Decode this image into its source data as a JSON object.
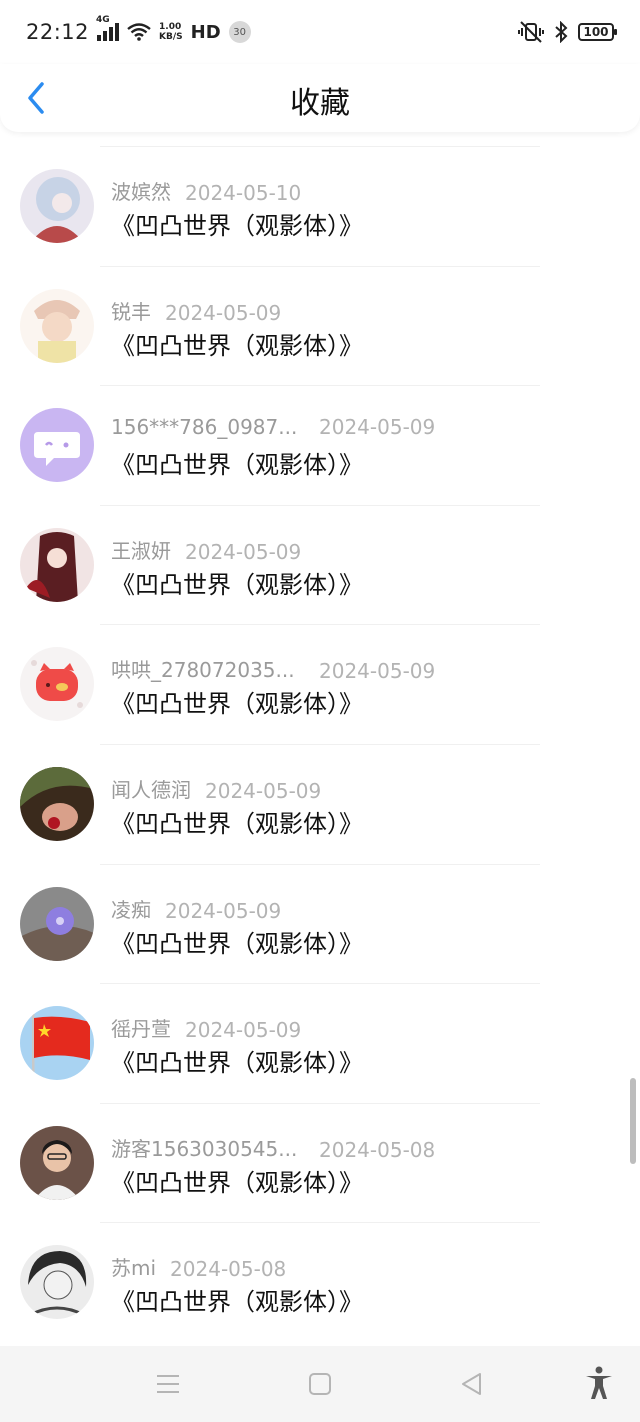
{
  "status": {
    "time": "22:12",
    "network": "4G",
    "speed_value": "1.00",
    "speed_unit": "KB/S",
    "hd": "HD",
    "notif_count": "30",
    "battery": "100"
  },
  "header": {
    "title": "收藏",
    "back_icon": "chevron-left-icon",
    "accent": "#2b8cf0"
  },
  "items": [
    {
      "name": "波嫔然",
      "date": "2024-05-10",
      "book": "《凹凸世界（观影体）》"
    },
    {
      "name": "锐丰",
      "date": "2024-05-09",
      "book": "《凹凸世界（观影体）》"
    },
    {
      "name": "156***786_0987...",
      "date": "2024-05-09",
      "book": "《凹凸世界（观影体）》"
    },
    {
      "name": "王淑妍",
      "date": "2024-05-09",
      "book": "《凹凸世界（观影体）》"
    },
    {
      "name": "哄哄_278072035...",
      "date": "2024-05-09",
      "book": "《凹凸世界（观影体）》"
    },
    {
      "name": "闻人德润",
      "date": "2024-05-09",
      "book": "《凹凸世界（观影体）》"
    },
    {
      "name": "凌痴",
      "date": "2024-05-09",
      "book": "《凹凸世界（观影体）》"
    },
    {
      "name": "徭丹萱",
      "date": "2024-05-09",
      "book": "《凹凸世界（观影体）》"
    },
    {
      "name": "游客1563030545...",
      "date": "2024-05-08",
      "book": "《凹凸世界（观影体）》"
    },
    {
      "name": "苏mi",
      "date": "2024-05-08",
      "book": "《凹凸世界（观影体）》"
    }
  ],
  "navbar": {
    "icons": [
      "menu-icon",
      "home-square-icon",
      "back-triangle-icon",
      "accessibility-icon"
    ]
  }
}
